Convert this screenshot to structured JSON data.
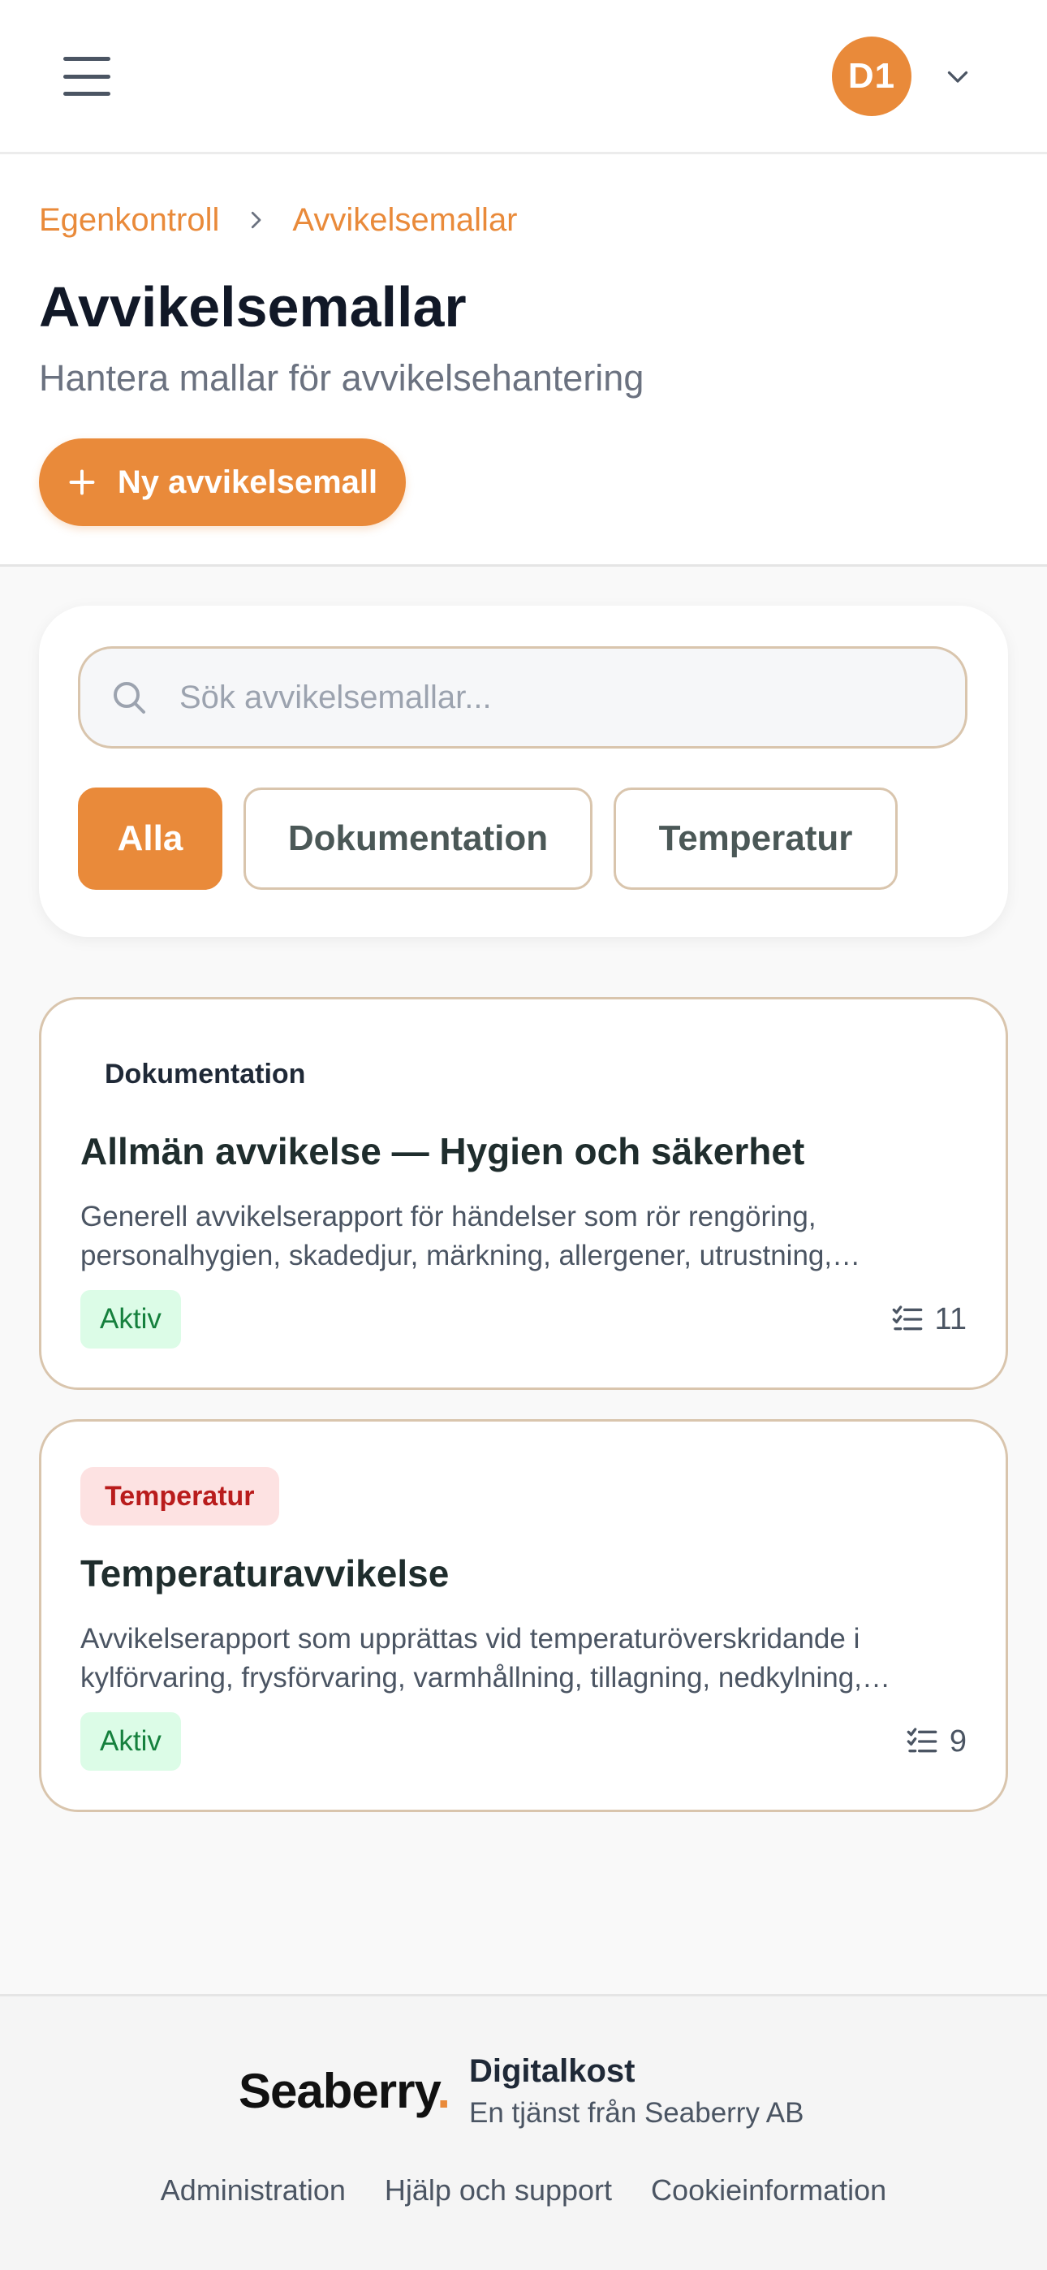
{
  "header": {
    "avatar_initials": "D1"
  },
  "breadcrumb": {
    "items": [
      "Egenkontroll",
      "Avvikelsemallar"
    ]
  },
  "page": {
    "title": "Avvikelsemallar",
    "subtitle": "Hantera mallar för avvikelsehantering",
    "new_button_label": "Ny avvikelsemall"
  },
  "search": {
    "placeholder": "Sök avvikelsemallar...",
    "value": ""
  },
  "filters": [
    {
      "label": "Alla",
      "active": true
    },
    {
      "label": "Dokumentation",
      "active": false
    },
    {
      "label": "Temperatur",
      "active": false
    }
  ],
  "templates": [
    {
      "category": "Dokumentation",
      "title": "Allmän avvikelse — Hygien och säkerhet",
      "description": "Generell avvikelserapport för händelser som rör rengöring, personalhygien, skadedjur, märkning, allergener, utrustning, mottagning av varor och övriga avvikelser i verksamheten.",
      "status": "Aktiv",
      "question_count": "11"
    },
    {
      "category": "Temperatur",
      "title": "Temperaturavvikelse",
      "description": "Avvikelserapport som upprättas vid temperaturöverskridande i kylförvaring, frysförvaring, varmhållning, tillagning, nedkylning, återuppvärmning och transport.",
      "status": "Aktiv",
      "question_count": "9"
    }
  ],
  "footer": {
    "logo_text": "Seaberry",
    "logo_dot": ".",
    "product_name": "Digitalkost",
    "product_sub": "En tjänst från Seaberry AB",
    "links": [
      "Administration",
      "Hjälp och support",
      "Cookieinformation"
    ]
  },
  "colors": {
    "accent": "#e98a3a",
    "status_active_bg": "#dcfce7",
    "status_active_text": "#15803d",
    "temp_badge_bg": "#fde2e2",
    "temp_badge_text": "#b91c1c"
  }
}
